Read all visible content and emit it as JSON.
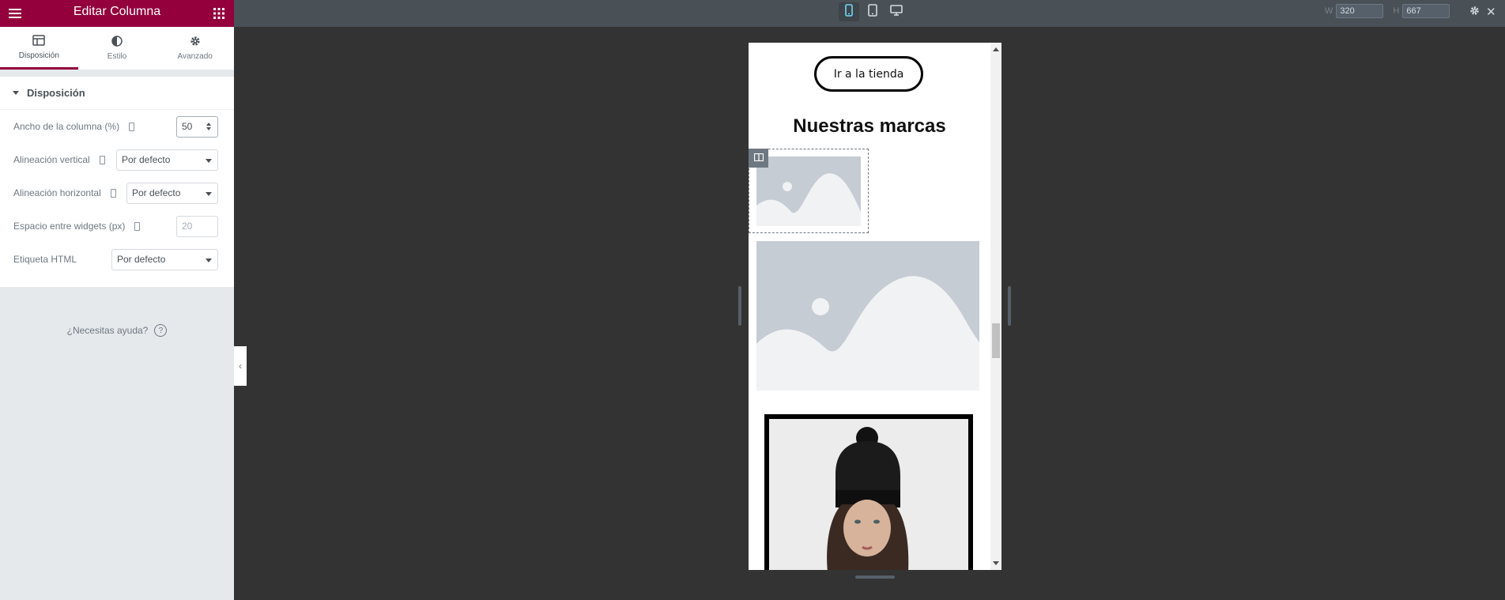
{
  "panel": {
    "title": "Editar Columna",
    "header_icons": [
      "hamburger-menu-icon",
      "apps-grid-icon"
    ],
    "tabs": [
      {
        "label": "Disposición",
        "icon": "layout-icon",
        "active": true
      },
      {
        "label": "Estilo",
        "icon": "half-circle-icon",
        "active": false
      },
      {
        "label": "Avanzado",
        "icon": "gear-icon",
        "active": false
      }
    ],
    "section": {
      "title": "Disposición",
      "expanded": true
    },
    "controls": {
      "column_width": {
        "label": "Ancho de la columna (%)",
        "value": "50"
      },
      "vertical_align": {
        "label": "Alineación vertical",
        "value": "Por defecto"
      },
      "horizontal_align": {
        "label": "Alineación horizontal",
        "value": "Por defecto"
      },
      "widget_space": {
        "label": "Espacio entre widgets (px)",
        "placeholder": "20"
      },
      "html_tag": {
        "label": "Etiqueta HTML",
        "value": "Por defecto"
      }
    },
    "help": {
      "label": "¿Necesitas ayuda?",
      "icon": "question-circle-icon"
    }
  },
  "topbar": {
    "devices": [
      {
        "name": "mobile",
        "icon": "mobile-icon",
        "active": true
      },
      {
        "name": "tablet",
        "icon": "tablet-icon",
        "active": false
      },
      {
        "name": "desktop",
        "icon": "desktop-icon",
        "active": false
      }
    ],
    "width_label": "W",
    "width_value": "320",
    "height_label": "H",
    "height_value": "667",
    "close_glyph": "✕"
  },
  "preview": {
    "shop_button": "Ir a la tienda",
    "brands_title": "Nuestras marcas"
  },
  "colors": {
    "brand": "#93003c",
    "panel_bg": "#e6e9ec",
    "canvas_bg": "#333333",
    "topbar_bg": "#495157",
    "active_device": "#71d7f7"
  }
}
